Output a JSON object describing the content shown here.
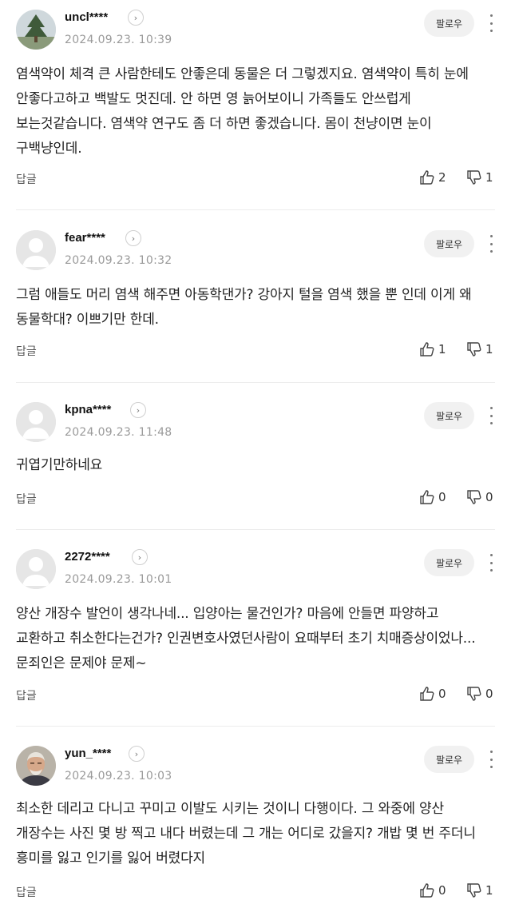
{
  "labels": {
    "follow": "팔로우",
    "reply": "답글"
  },
  "comments": [
    {
      "username": "uncl****",
      "timestamp": "2024.09.23. 10:39",
      "avatar": "tree-photo",
      "text": "염색약이 체격 큰 사람한테도 안좋은데 동물은 더 그렇겠지요. 염색약이 특히 눈에 안좋다고하고 백발도 멋진데. 안 하면 영 늙어보이니 가족들도 안쓰럽게 보는것같습니다. 염색약 연구도 좀 더 하면 좋겠습니다. 몸이 천냥이면 눈이 구백냥인데.",
      "likes": "2",
      "dislikes": "1"
    },
    {
      "username": "fear****",
      "timestamp": "2024.09.23. 10:32",
      "avatar": "default-user",
      "text": "그럼 애들도 머리 염색 해주면 아동학댄가? 강아지 털을 염색 했을 뿐 인데 이게 왜 동물학대? 이쁘기만 한데.",
      "likes": "1",
      "dislikes": "1"
    },
    {
      "username": "kpna****",
      "timestamp": "2024.09.23. 11:48",
      "avatar": "default-user",
      "text": "귀엽기만하네요",
      "likes": "0",
      "dislikes": "0"
    },
    {
      "username": "2272****",
      "timestamp": "2024.09.23. 10:01",
      "avatar": "default-user",
      "text": "양산 개장수 발언이 생각나네... 입양아는 물건인가? 마음에 안들면 파양하고 교환하고 취소한다는건가? 인권변호사였던사람이 요때부터 초기 치매증상이었나... 문죄인은 문제야 문제~",
      "likes": "0",
      "dislikes": "0"
    },
    {
      "username": "yun_****",
      "timestamp": "2024.09.23. 10:03",
      "avatar": "person-photo",
      "text": "최소한 데리고 다니고 꾸미고 이발도 시키는 것이니 다행이다. 그 와중에 양산 개장수는 사진 몇 방 찍고 내다 버렸는데 그 개는 어디로 갔을지? 개밥 몇 번 주더니 흥미를 잃고 인기를 잃어 버렸다지",
      "likes": "0",
      "dislikes": "1"
    }
  ]
}
